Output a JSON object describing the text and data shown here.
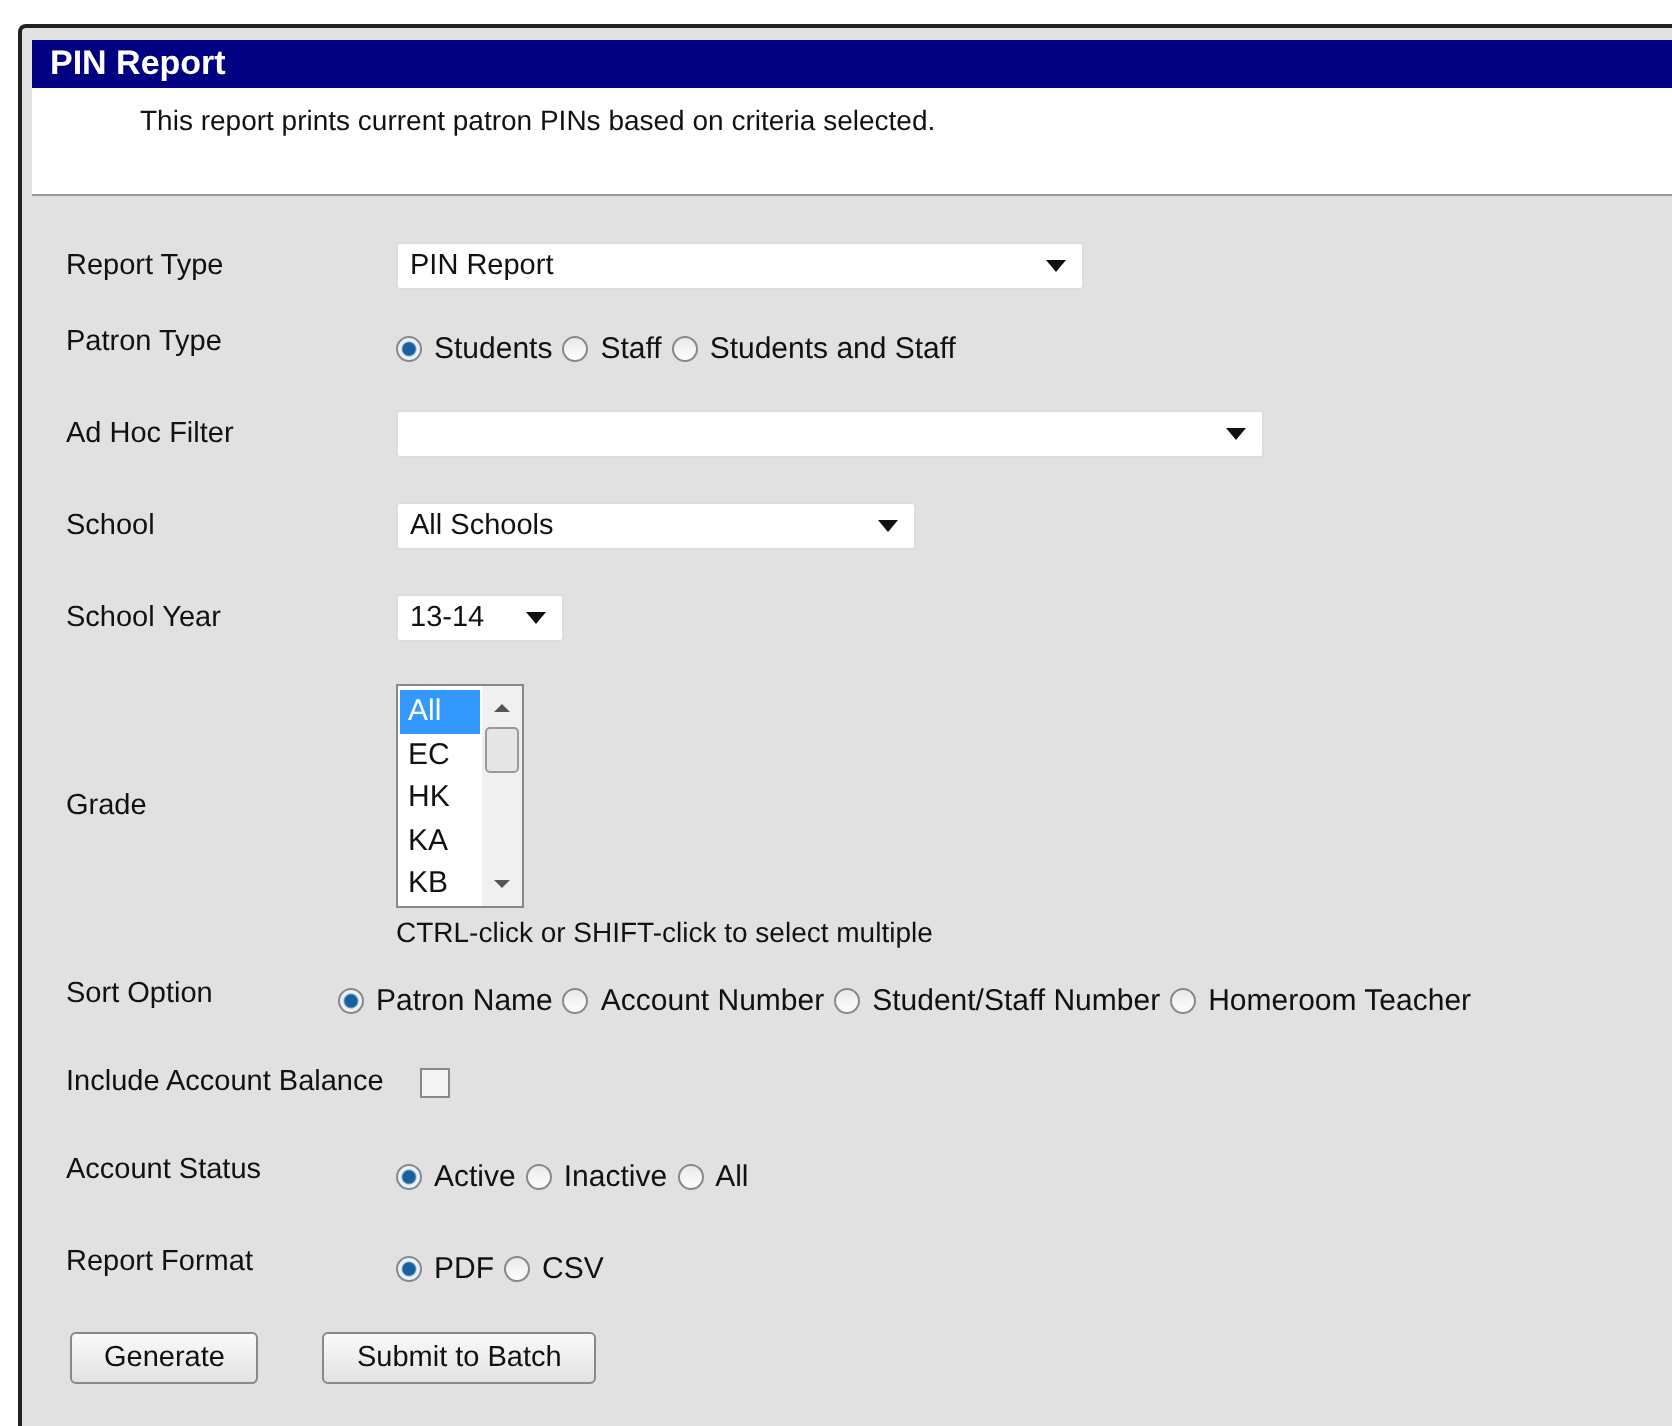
{
  "window": {
    "title": "PIN Report",
    "description": "This report prints current patron PINs based on criteria selected."
  },
  "fields": [
    {
      "kind": "dropdown",
      "label": "Report Type",
      "value": "PIN Report"
    },
    {
      "kind": "radio",
      "label": "Patron Type",
      "options": [
        {
          "label": "Students",
          "selected": true
        },
        {
          "label": "Staff",
          "selected": false
        },
        {
          "label": "Students and Staff",
          "selected": false
        }
      ]
    },
    {
      "kind": "dropdown",
      "label": "Ad Hoc Filter"
    },
    {
      "kind": "dropdown",
      "label": "School",
      "value": "All Schools"
    },
    {
      "kind": "dropdown",
      "label": "School Year",
      "value": "13-14"
    },
    {
      "kind": "listbox",
      "label": "Grade",
      "items": [
        {
          "label": "All",
          "selected": true
        },
        {
          "label": "EC",
          "selected": false
        },
        {
          "label": "HK",
          "selected": false
        },
        {
          "label": "KA",
          "selected": false
        },
        {
          "label": "KB",
          "selected": false
        }
      ],
      "hint": "CTRL-click or SHIFT-click to select multiple"
    },
    {
      "kind": "radio",
      "label": "Sort Option",
      "options": [
        {
          "label": "Patron Name",
          "selected": true
        },
        {
          "label": "Account Number",
          "selected": false
        },
        {
          "label": "Student/Staff Number",
          "selected": false
        },
        {
          "label": "Homeroom Teacher",
          "selected": false
        }
      ]
    },
    {
      "kind": "checkbox",
      "label": "Include Account Balance",
      "checked": false
    },
    {
      "kind": "radio",
      "label": "Account Status",
      "options": [
        {
          "label": "Active",
          "selected": true
        },
        {
          "label": "Inactive",
          "selected": false
        },
        {
          "label": "All",
          "selected": false
        }
      ]
    },
    {
      "kind": "radio",
      "label": "Report Format",
      "options": [
        {
          "label": "PDF",
          "selected": true
        },
        {
          "label": "CSV",
          "selected": false
        }
      ]
    }
  ],
  "buttons": [
    "Generate",
    "Submit to Batch"
  ]
}
